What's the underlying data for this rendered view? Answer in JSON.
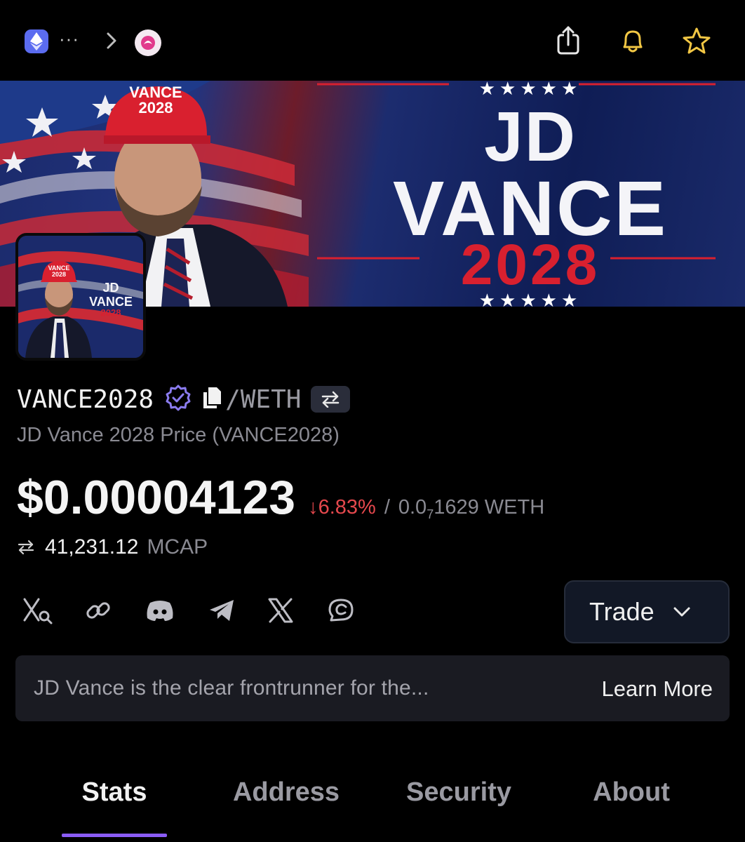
{
  "topbar": {
    "more": "···",
    "network_icon": "ethereum-icon",
    "token_icon": "pink-token-icon",
    "actions": [
      "share-icon",
      "bell-icon",
      "star-icon"
    ],
    "bell_color": "#f2c744"
  },
  "banner": {
    "hat_text": "VANCE\n2028",
    "line1": "JD",
    "line2": "VANCE",
    "line3": "2028",
    "stars": "★★★★★"
  },
  "token": {
    "symbol": "VANCE2028",
    "pair": "/WETH",
    "subtitle": "JD Vance 2028 Price (VANCE2028)",
    "price": "$0.00004123",
    "change": "↓6.83%",
    "slash": "/",
    "weth_price_prefix": "0.0",
    "weth_price_sub": "7",
    "weth_price_suffix": "1629 WETH",
    "mcap_value": "41,231.12",
    "mcap_label": "MCAP"
  },
  "colors": {
    "negative": "#e5484d",
    "accent": "#8b5cf6",
    "verified": "#8b7cf0"
  },
  "social": {
    "icons": [
      "x-search-icon",
      "link-icon",
      "discord-icon",
      "telegram-icon",
      "x-icon",
      "chat-icon"
    ],
    "trade_label": "Trade"
  },
  "description": {
    "text": "JD Vance is  the clear frontrunner for the...",
    "learn_more": "Learn More"
  },
  "tabs": {
    "items": [
      "Stats",
      "Address",
      "Security",
      "About"
    ],
    "active": "Stats"
  }
}
